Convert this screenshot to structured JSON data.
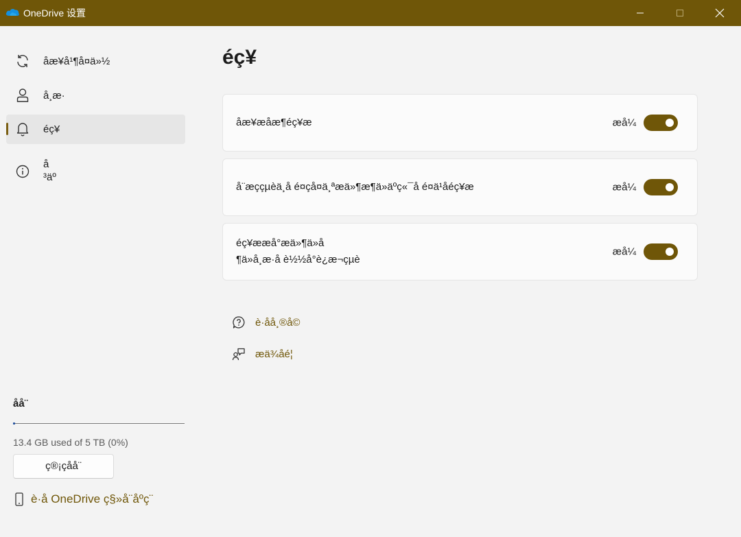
{
  "window": {
    "title": "OneDrive 设置",
    "icon": "onedrive-cloud-icon",
    "controls": [
      "minimize-icon",
      "maximize-icon",
      "close-icon"
    ]
  },
  "sidebar": {
    "items": [
      {
        "label": "åæ¥å¹¶å¤ä»½",
        "icon": "sync-icon",
        "active": false
      },
      {
        "label": "å¸æ·",
        "icon": "account-icon",
        "active": true
      },
      {
        "label": "éç¥",
        "icon": "bell-icon",
        "active": true
      },
      {
        "label": "å\n³äº",
        "icon": "info-icon",
        "active": false
      }
    ],
    "storage": {
      "title": "åå¨",
      "used_text": "13.4 GB used of 5 TB (0%)",
      "used_fraction": 0.01,
      "manage_label": "ç®¡çåå¨",
      "mobile_label": "è·å OneDrive ç§»å¨åºç¨"
    }
  },
  "main": {
    "title": "éç¥",
    "settings": [
      {
        "label": "åæ¥æåæ¶éç¥æ",
        "state": "æå¼",
        "on": true
      },
      {
        "label": "å¨æççµèä¸å é¤çå¤ä¸ªæä»¶æ¶ä»äºç«¯å é¤ä¹åéç¥æ",
        "state": "æå¼",
        "on": true
      },
      {
        "label": "éç¥ææå°æä»¶ä»å\n¶ä»å¸æ·å è½½å°è¿æ¬çµè",
        "state": "æå¼",
        "on": true
      }
    ],
    "links": [
      {
        "label": "è·åå¸®å©",
        "icon": "help-chat-icon"
      },
      {
        "label": "æä¾åé¦",
        "icon": "feedback-icon"
      }
    ]
  },
  "colors": {
    "accent": "#6f5608",
    "titlebar": "#6f5608",
    "background": "#f3f3f3",
    "card": "#fbfbfb",
    "storage_bar": "#1f4e9c"
  }
}
